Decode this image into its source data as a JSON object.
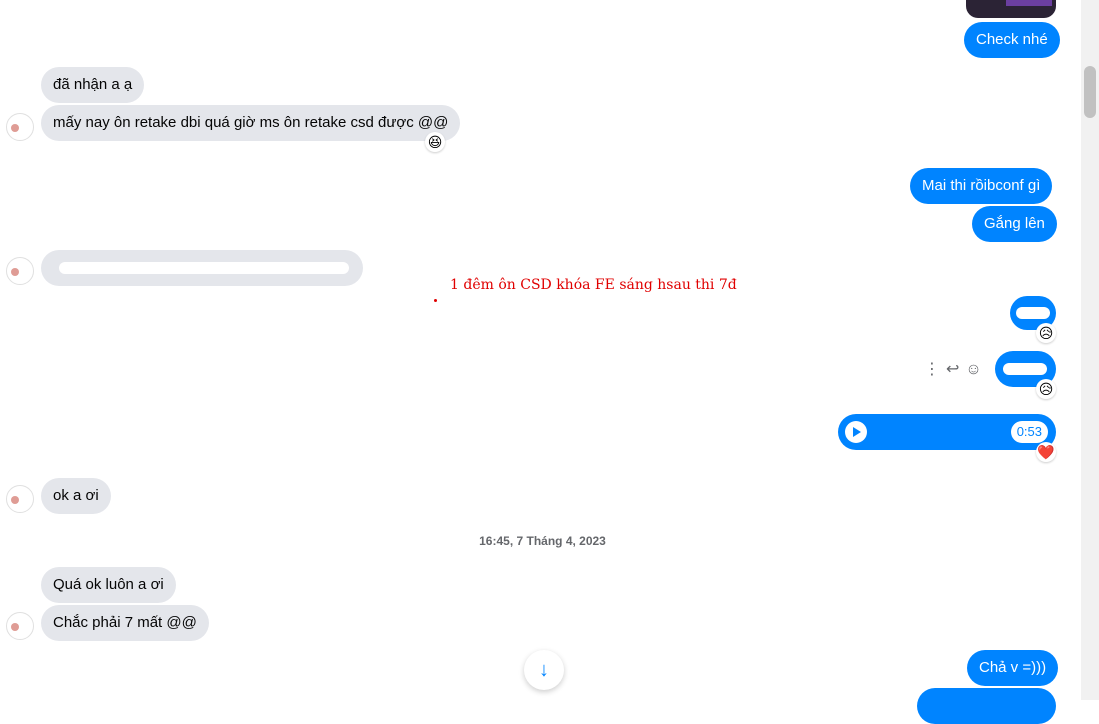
{
  "messages": {
    "out_check": "Check nhé",
    "in_received": "đã nhận a ạ",
    "in_retake": "mấy nay ôn retake dbi quá giờ ms ôn retake csd được @@",
    "in_retake_react": "😆",
    "out_mai": "Mai thi rồibconf gì",
    "out_gang": "Gắng lên",
    "in_redacted": "",
    "out_redacted_1_react": "😥",
    "out_redacted_2_react": "😥",
    "audio_duration": "0:53",
    "audio_react": "❤️",
    "in_ok": "ok a ơi",
    "timestamp": "16:45, 7 Tháng 4, 2023",
    "in_qua_ok": "Quá ok luôn a ơi",
    "in_chac": "Chắc phải 7 mất @@",
    "out_cha": "Chả v =)))"
  },
  "annotation": {
    "note": "1 đêm ôn CSD khóa FE sáng hsau thi 7đ"
  },
  "icons": {
    "more": "more-vertical-icon",
    "reply": "reply-icon",
    "emoji": "smiley-icon",
    "scroll_down": "arrow-down-icon"
  },
  "colors": {
    "outgoing": "#0084ff",
    "incoming": "#e4e6eb",
    "annotation": "#e00000"
  }
}
